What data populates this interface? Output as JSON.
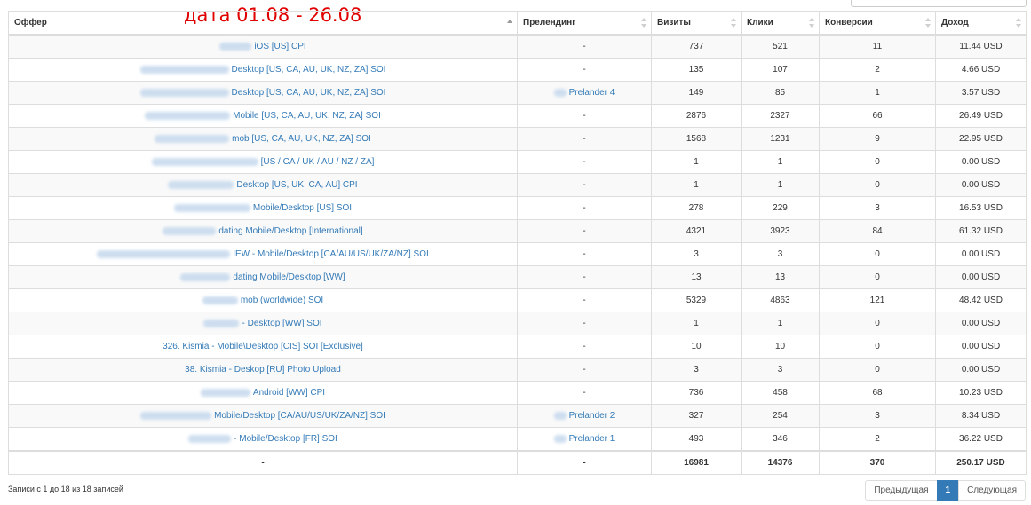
{
  "date_note": "дата 01.08 - 26.08",
  "columns": {
    "offer": "Оффер",
    "prelander": "Прелендинг",
    "visits": "Визиты",
    "clicks": "Клики",
    "conversions": "Конверсии",
    "income": "Доход"
  },
  "rows": [
    {
      "offer": "iOS [US] CPI",
      "prelander": "-",
      "visits": "737",
      "clicks": "521",
      "conversions": "11",
      "income": "11.44 USD"
    },
    {
      "offer": "Desktop [US, CA, AU, UK, NZ, ZA] SOI",
      "prelander": "-",
      "visits": "135",
      "clicks": "107",
      "conversions": "2",
      "income": "4.66 USD"
    },
    {
      "offer": "Desktop [US, CA, AU, UK, NZ, ZA] SOI",
      "prelander": "Prelander 4",
      "visits": "149",
      "clicks": "85",
      "conversions": "1",
      "income": "3.57 USD"
    },
    {
      "offer": "Mobile [US, CA, AU, UK, NZ, ZA] SOI",
      "prelander": "-",
      "visits": "2876",
      "clicks": "2327",
      "conversions": "66",
      "income": "26.49 USD"
    },
    {
      "offer": "mob [US, CA, AU, UK, NZ, ZA] SOI",
      "prelander": "-",
      "visits": "1568",
      "clicks": "1231",
      "conversions": "9",
      "income": "22.95 USD"
    },
    {
      "offer": "[US / CA / UK / AU / NZ / ZA]",
      "prelander": "-",
      "visits": "1",
      "clicks": "1",
      "conversions": "0",
      "income": "0.00 USD"
    },
    {
      "offer": "Desktop [US, UK, CA, AU] CPI",
      "prelander": "-",
      "visits": "1",
      "clicks": "1",
      "conversions": "0",
      "income": "0.00 USD"
    },
    {
      "offer": "Mobile/Desktop [US] SOI",
      "prelander": "-",
      "visits": "278",
      "clicks": "229",
      "conversions": "3",
      "income": "16.53 USD"
    },
    {
      "offer": "dating Mobile/Desktop [International]",
      "prelander": "-",
      "visits": "4321",
      "clicks": "3923",
      "conversions": "84",
      "income": "61.32 USD"
    },
    {
      "offer": "IEW - Mobile/Desktop [CA/AU/US/UK/ZA/NZ] SOI",
      "prelander": "-",
      "visits": "3",
      "clicks": "3",
      "conversions": "0",
      "income": "0.00 USD"
    },
    {
      "offer": "dating Mobile/Desktop [WW]",
      "prelander": "-",
      "visits": "13",
      "clicks": "13",
      "conversions": "0",
      "income": "0.00 USD"
    },
    {
      "offer": "mob (worldwide) SOI",
      "prelander": "-",
      "visits": "5329",
      "clicks": "4863",
      "conversions": "121",
      "income": "48.42 USD"
    },
    {
      "offer": "- Desktop [WW] SOI",
      "prelander": "-",
      "visits": "1",
      "clicks": "1",
      "conversions": "0",
      "income": "0.00 USD"
    },
    {
      "offer": "326. Kismia - Mobile\\Desktop [CIS] SOI [Exclusive]",
      "prelander": "-",
      "visits": "10",
      "clicks": "10",
      "conversions": "0",
      "income": "0.00 USD"
    },
    {
      "offer": "38. Kismia - Deskop [RU] Photo Upload",
      "prelander": "-",
      "visits": "3",
      "clicks": "3",
      "conversions": "0",
      "income": "0.00 USD"
    },
    {
      "offer": "Android [WW] CPI",
      "prelander": "-",
      "visits": "736",
      "clicks": "458",
      "conversions": "68",
      "income": "10.23 USD"
    },
    {
      "offer": "Mobile/Desktop [CA/AU/US/UK/ZA/NZ] SOI",
      "prelander": "Prelander 2",
      "visits": "327",
      "clicks": "254",
      "conversions": "3",
      "income": "8.34 USD"
    },
    {
      "offer": "- Mobile/Desktop [FR] SOI",
      "prelander": "Prelander 1",
      "visits": "493",
      "clicks": "346",
      "conversions": "2",
      "income": "36.22 USD"
    }
  ],
  "totals": {
    "offer": "-",
    "prelander": "-",
    "visits": "16981",
    "clicks": "14376",
    "conversions": "370",
    "income": "250.17 USD"
  },
  "footer_info": "Записи с 1 до 18 из 18 записей",
  "pagination": {
    "prev_label": "Предыдущая",
    "page": "1",
    "next_label": "Следующая"
  },
  "colors": {
    "link": "#337ab7",
    "annotation": "#e00000",
    "active_page": "#337ab7"
  }
}
